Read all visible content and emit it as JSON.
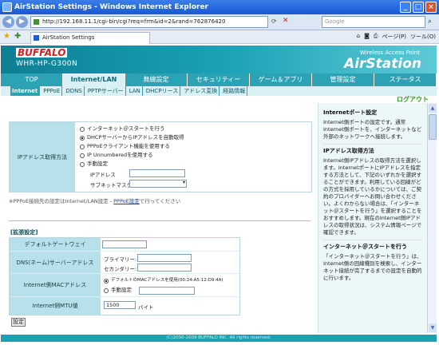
{
  "window": {
    "title": "AirStation Settings - Windows Internet Explorer"
  },
  "browser": {
    "url": "http://192.168.11.1/cgi-bin/cgi?req=frm&id=2&rand=762876420",
    "search_placeholder": "Google",
    "tab_label": "AirStation Settings",
    "tools": [
      "ページ(P)",
      "ツール(O)"
    ]
  },
  "brand": {
    "logo": "BUFFALO",
    "model": "WHR-HP-G300N",
    "tagline": "Wireless Access Point",
    "product": "AirStation"
  },
  "main_nav": [
    "TOP",
    "Internet/LAN",
    "無線設定",
    "セキュリティー",
    "ゲーム＆アプリ",
    "管理設定",
    "ステータス"
  ],
  "main_nav_active": "Internet/LAN",
  "sub_nav": [
    "Internet",
    "PPPoE",
    "DDNS",
    "PPTPサーバー",
    "LAN",
    "DHCPリース",
    "アドレス変換",
    "経路情報"
  ],
  "logout": "ログアウト",
  "ip_section": {
    "label": "IPアドレス取得方法",
    "options": [
      {
        "label": "インターネット＠スタートを行う",
        "checked": false
      },
      {
        "label": "DHCPサーバーからIPアドレスを自動取得",
        "checked": true
      },
      {
        "label": "PPPoEクライアント機能を使用する",
        "checked": false
      },
      {
        "label": "IP Unnumberedを使用する",
        "checked": false
      },
      {
        "label": "手動設定",
        "checked": false
      }
    ],
    "ip_label": "IPアドレス",
    "mask_label": "サブネットマスク"
  },
  "note": {
    "before": "※PPPoE接続先の設定はInternet/LAN設定 - ",
    "link": "PPPoE設定",
    "after": "で行ってください"
  },
  "ext": {
    "heading": "[拡張設定]",
    "gateway_label": "デフォルトゲートウェイ",
    "dns_label": "DNS(ネーム)サーバーアドレス",
    "dns_primary": "プライマリー:",
    "dns_secondary": "セカンダリー:",
    "mac_label": "Internet側MACアドレス",
    "mac_default": "デフォルトのMACアドレスを使用(00:24:A5:12:D9:4A)",
    "mac_manual": "手動設定",
    "mtu_label": "Internet側MTU値",
    "mtu_value": "1500",
    "mtu_unit": "バイト",
    "submit": "設定"
  },
  "footer": "(C)2000-2009 BUFFALO INC. All rights reserved.",
  "help": {
    "h1": "Internetポート設定",
    "p1": "Internet側ポートの設定です。通常Internet側ポートを、インターネットなど外部のネットワークへ接続します。",
    "h2": "IPアドレス取得方法",
    "p2": "Internet側IPアドレスの取得方法を選択します。InternetポートにIPアドレスを指定する方法として、下記のいずれかを選択することができます。利用している回線がどの方式を採用しているかについては、ご契約のプロバイダーへお問い合わせください。よくわからない場合は、「インターネット＠スタートを行う」を選択することをおすすめします。現在のInternet側IPアドレスの取得状況は、システム情報ページで確認できます。",
    "h3": "インターネット＠スタートを行う",
    "p3": "「インターネット＠スタートを行う」は、Internet側の回線種別を検索し、インターネット接続が完了するまでの設定を自動的に行います。"
  }
}
